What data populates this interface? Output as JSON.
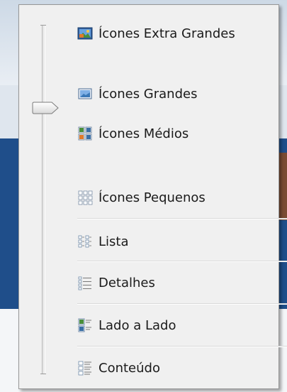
{
  "view_menu": {
    "items": [
      {
        "label": "Ícones Extra Grandes",
        "icon": "extra-large-icons-icon",
        "selected": false
      },
      {
        "label": "Ícones Grandes",
        "icon": "large-icons-icon",
        "selected": false
      },
      {
        "label": "Ícones Médios",
        "icon": "medium-icons-icon",
        "selected": false
      },
      {
        "label": "Ícones Pequenos",
        "icon": "small-icons-icon",
        "selected": false
      },
      {
        "label": "Lista",
        "icon": "list-icon",
        "selected": false
      },
      {
        "label": "Detalhes",
        "icon": "details-icon",
        "selected": false
      },
      {
        "label": "Lado a Lado",
        "icon": "tiles-icon",
        "selected": false
      },
      {
        "label": "Conteúdo",
        "icon": "content-icon",
        "selected": false
      }
    ]
  },
  "colors": {
    "menu_bg": "#f0f0f0",
    "border": "#979797",
    "accent_blue": "#3a6ea5",
    "accent_green": "#4a8f3a",
    "accent_orange": "#e07a2a"
  }
}
